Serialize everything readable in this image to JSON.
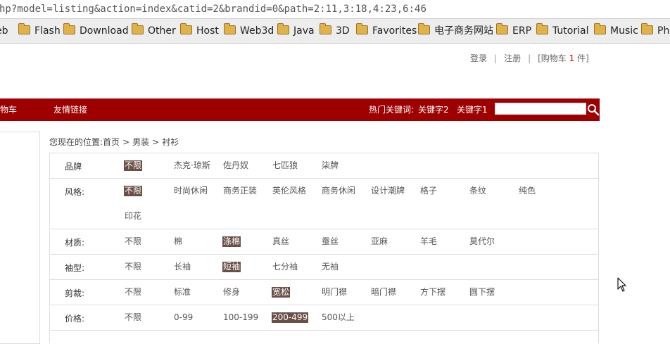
{
  "browser": {
    "url": "hp?model=listing&action=index&catid=2&brandid=0&path=2:11,3:18,4:23,6:46",
    "bookmarks": [
      "eb",
      "Flash",
      "Download",
      "Other",
      "Host",
      "Web3d",
      "Java",
      "3D",
      "Favorites",
      "电子商务网站",
      "ERP",
      "Tutorial",
      "Music",
      "Php"
    ]
  },
  "top_links": {
    "login": "登录",
    "register": "注册",
    "cart_prefix": "[购物车",
    "cart_count": "1",
    "cart_suffix": "件]",
    "sep": "|"
  },
  "nav": {
    "items": [
      "物车",
      "友情链接"
    ],
    "hot_label": "热门关键词:",
    "hot_keywords": [
      "关键字2",
      "关键字1"
    ],
    "search_icon": "search-icon"
  },
  "breadcrumb": {
    "prefix": "您现在的位置:",
    "items": [
      "首页",
      "男装",
      "衬衫"
    ],
    "sep": ">"
  },
  "filters": [
    {
      "label": "品牌",
      "options": [
        "不限",
        "杰克·琼斯",
        "佐丹奴",
        "七匹狼",
        "柒牌"
      ],
      "selected": 0
    },
    {
      "label": "风格:",
      "options": [
        "不限",
        "时尚休闲",
        "商务正装",
        "英伦风格",
        "商务休闲",
        "设计潮牌",
        "格子",
        "条纹",
        "纯色",
        "印花"
      ],
      "selected": 0
    },
    {
      "label": "材质:",
      "options": [
        "不限",
        "棉",
        "涤棉",
        "真丝",
        "蚕丝",
        "亚麻",
        "羊毛",
        "莫代尔"
      ],
      "selected": 2
    },
    {
      "label": "袖型:",
      "options": [
        "不限",
        "长袖",
        "短袖",
        "七分袖",
        "无袖"
      ],
      "selected": 2
    },
    {
      "label": "剪裁:",
      "options": [
        "不限",
        "标准",
        "修身",
        "宽松",
        "明门襟",
        "暗门襟",
        "方下摆",
        "圆下摆"
      ],
      "selected": 3
    },
    {
      "label": "价格:",
      "options": [
        "不限",
        "0-99",
        "100-199",
        "200-499",
        "500以上"
      ],
      "selected": 3
    }
  ],
  "colors": {
    "nav_bg": "#9e0000",
    "selected_bg": "#6a4f47"
  }
}
